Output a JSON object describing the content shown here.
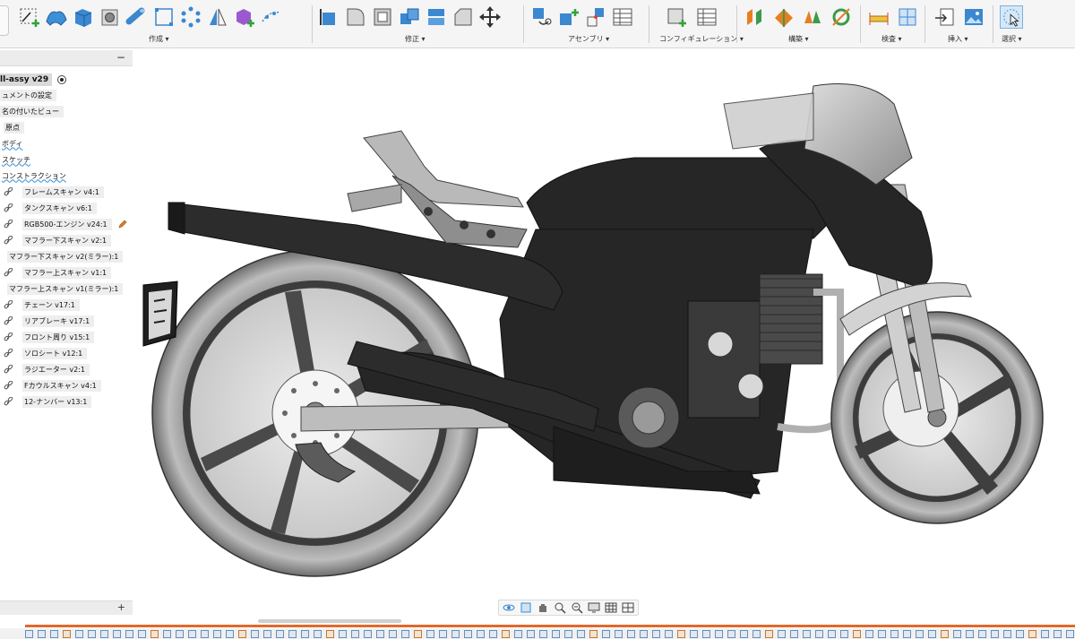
{
  "toolbar": {
    "groups": [
      {
        "id": "create",
        "label": "作成 ▾"
      },
      {
        "id": "modify",
        "label": "修正 ▾"
      },
      {
        "id": "assemble",
        "label": "アセンブリ ▾"
      },
      {
        "id": "configure",
        "label": "コンフィギュレーション ▾"
      },
      {
        "id": "construct",
        "label": "構築 ▾"
      },
      {
        "id": "inspect",
        "label": "検査 ▾"
      },
      {
        "id": "insert",
        "label": "挿入 ▾"
      },
      {
        "id": "select",
        "label": "選択 ▾"
      }
    ]
  },
  "browser": {
    "collapse_label": "−",
    "root": "ll-assy v29",
    "items": [
      {
        "label": "ュメントの設定",
        "type": "folder"
      },
      {
        "label": "名の付いたビュー",
        "type": "folder"
      },
      {
        "label": "原点",
        "type": "plain"
      },
      {
        "label": "ボディ",
        "type": "wavy"
      },
      {
        "label": "スケッチ",
        "type": "wavy"
      },
      {
        "label": "コンストラクション",
        "type": "wavy"
      },
      {
        "label": "フレームスキャン v4:1",
        "type": "link"
      },
      {
        "label": "タンクスキャン v6:1",
        "type": "link"
      },
      {
        "label": "RGB500-エンジン v24:1",
        "type": "link-edit"
      },
      {
        "label": "マフラー下スキャン v2:1",
        "type": "link"
      },
      {
        "label": "マフラー下スキャン v2(ミラー):1",
        "type": "noicon"
      },
      {
        "label": "マフラー上スキャン v1:1",
        "type": "link"
      },
      {
        "label": "マフラー上スキャン v1(ミラー):1",
        "type": "noicon"
      },
      {
        "label": "チェーン v17:1",
        "type": "link"
      },
      {
        "label": "リアブレーキ v17:1",
        "type": "link"
      },
      {
        "label": "フロント周り v15:1",
        "type": "link"
      },
      {
        "label": "ソロシート v12:1",
        "type": "link"
      },
      {
        "label": "ラジエーター v2:1",
        "type": "link"
      },
      {
        "label": "Fカウルスキャン v4:1",
        "type": "link"
      },
      {
        "label": "12-ナンバー v13:1",
        "type": "link"
      }
    ],
    "add_label": "+"
  },
  "colors": {
    "accent": "#2f8fd8",
    "timeline": "#e06a2c",
    "toolbar_bg": "#f5f5f5"
  }
}
